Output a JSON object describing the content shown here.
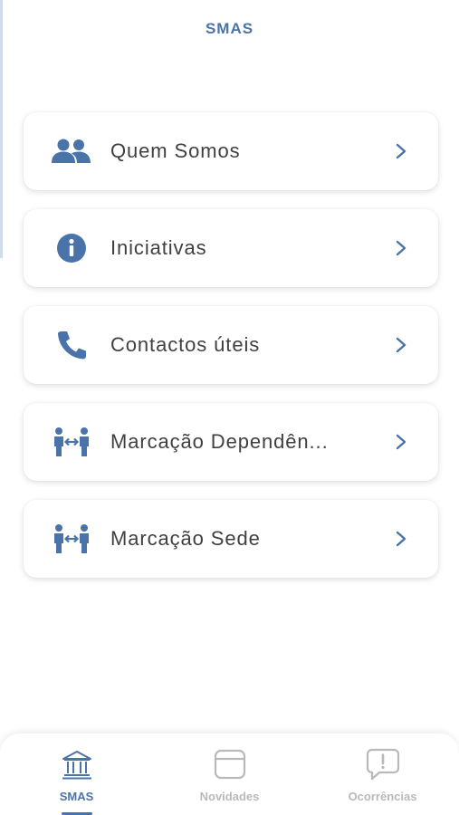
{
  "colors": {
    "accent": "#4a73aa",
    "inactive": "#b9b9b9",
    "text": "#404040"
  },
  "header": {
    "title": "SMAS"
  },
  "menu": {
    "items": [
      {
        "label": "Quem Somos",
        "icon": "users-icon"
      },
      {
        "label": "Iniciativas",
        "icon": "info-icon"
      },
      {
        "label": "Contactos úteis",
        "icon": "phone-icon"
      },
      {
        "label": "Marcação Dependên...",
        "icon": "people-transfer-icon"
      },
      {
        "label": "Marcação Sede",
        "icon": "people-transfer-icon"
      }
    ]
  },
  "tabbar": {
    "tabs": [
      {
        "label": "SMAS",
        "icon": "bank-icon",
        "active": true
      },
      {
        "label": "Novidades",
        "icon": "news-icon",
        "active": false
      },
      {
        "label": "Ocorrências",
        "icon": "alert-chat-icon",
        "active": false
      }
    ]
  }
}
